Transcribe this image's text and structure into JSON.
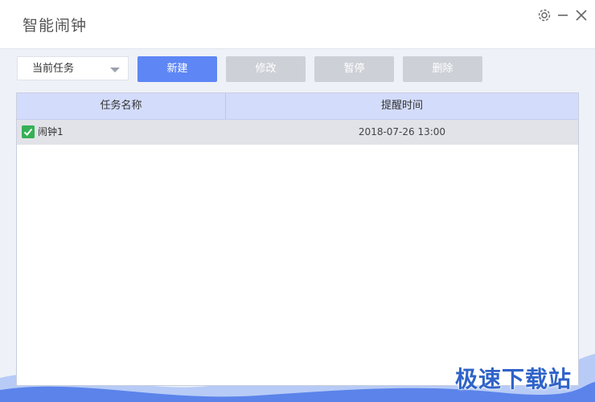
{
  "app": {
    "title": "智能闹钟"
  },
  "window_controls": {
    "settings_icon": "gear-icon",
    "minimize_icon": "minimize-icon",
    "close_icon": "close-icon"
  },
  "toolbar": {
    "filter_selected": "当前任务",
    "new_label": "新建",
    "edit_label": "修改",
    "pause_label": "暂停",
    "delete_label": "删除"
  },
  "table": {
    "columns": [
      "任务名称",
      "提醒时间"
    ],
    "rows": [
      {
        "name": "闹钟1",
        "time": "2018-07-26 13:00",
        "checked": true
      }
    ]
  },
  "watermark": {
    "text": "极速下载站"
  },
  "colors": {
    "accent": "#5e86f5",
    "disabled": "#cdd0d6",
    "header_bg": "#d3dcfb",
    "check": "#36b056",
    "wave": "#5b83ea"
  }
}
